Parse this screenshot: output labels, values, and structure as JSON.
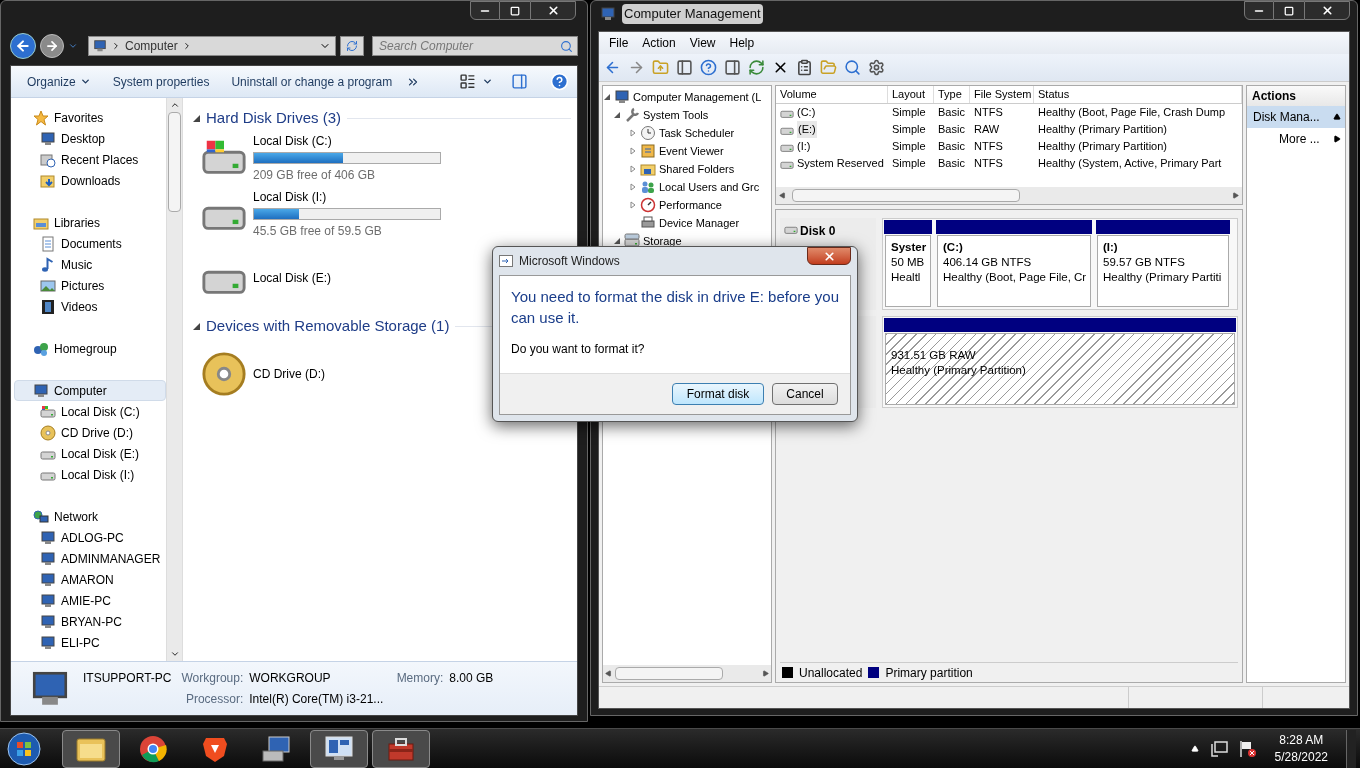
{
  "explorer": {
    "address": {
      "crumbs": [
        "Computer"
      ]
    },
    "search": {
      "placeholder": "Search Computer"
    },
    "commands": [
      {
        "label": "Organize",
        "kind": "menu"
      },
      {
        "label": "System properties",
        "kind": "plain"
      },
      {
        "label": "Uninstall or change a program",
        "kind": "plain"
      }
    ],
    "nav": [
      {
        "label": "Favorites",
        "kind": "star",
        "selected": false,
        "children": [
          {
            "label": "Desktop",
            "kind": "desktop",
            "selected": false
          },
          {
            "label": "Recent Places",
            "kind": "recent",
            "selected": false
          },
          {
            "label": "Downloads",
            "kind": "downloads",
            "selected": false
          }
        ]
      },
      {
        "label": "Libraries",
        "kind": "libraries",
        "selected": false,
        "children": [
          {
            "label": "Documents",
            "kind": "documents",
            "selected": false
          },
          {
            "label": "Music",
            "kind": "music",
            "selected": false
          },
          {
            "label": "Pictures",
            "kind": "pictures",
            "selected": false
          },
          {
            "label": "Videos",
            "kind": "videos",
            "selected": false
          }
        ]
      },
      {
        "label": "Homegroup",
        "kind": "homegroup",
        "selected": false
      },
      {
        "label": "Computer",
        "kind": "computer",
        "selected": true,
        "children": [
          {
            "label": "Local Disk (C:)",
            "kind": "systemdisk",
            "selected": false
          },
          {
            "label": "CD Drive (D:)",
            "kind": "cd",
            "selected": false
          },
          {
            "label": "Local Disk (E:)",
            "kind": "disk",
            "selected": false
          },
          {
            "label": "Local Disk (I:)",
            "kind": "disk",
            "selected": false
          }
        ]
      },
      {
        "label": "Network",
        "kind": "network",
        "selected": false,
        "children": [
          {
            "label": "ADLOG-PC",
            "kind": "pc",
            "selected": false
          },
          {
            "label": "ADMINMANAGER",
            "kind": "pc",
            "selected": false
          },
          {
            "label": "AMARON",
            "kind": "pc",
            "selected": false
          },
          {
            "label": "AMIE-PC",
            "kind": "pc",
            "selected": false
          },
          {
            "label": "BRYAN-PC",
            "kind": "pc",
            "selected": false
          },
          {
            "label": "ELI-PC",
            "kind": "pc",
            "selected": false
          }
        ]
      }
    ],
    "groups": [
      {
        "title": "Hard Disk Drives (3)",
        "items": [
          {
            "name": "Local Disk (C:)",
            "kind": "systemdisk",
            "level": 0.48,
            "free": "209 GB free of 406 GB"
          },
          {
            "name": "Local Disk (I:)",
            "kind": "disk",
            "level": 0.24,
            "free": "45.5 GB free of 59.5 GB"
          },
          {
            "name": "Local Disk (E:)",
            "kind": "disk"
          }
        ]
      },
      {
        "title": "Devices with Removable Storage (1)",
        "items": [
          {
            "name": "CD Drive (D:)",
            "kind": "cd"
          }
        ]
      }
    ],
    "details": {
      "name": "ITSUPPORT-PC",
      "workgroup": {
        "label": "Workgroup:",
        "value": "WORKGROUP"
      },
      "memory": {
        "label": "Memory:",
        "value": "8.00 GB"
      },
      "processor": {
        "label": "Processor:",
        "value": "Intel(R) Core(TM) i3-21..."
      }
    }
  },
  "cm": {
    "title": "Computer Management",
    "menu": [
      "File",
      "Action",
      "View",
      "Help"
    ],
    "tree": [
      {
        "label": "Computer Management (L",
        "kind": "cm",
        "expanded": true,
        "children": [
          {
            "label": "System Tools",
            "kind": "tools",
            "expanded": true,
            "children": [
              {
                "label": "Task Scheduler",
                "kind": "clock",
                "expanded": false
              },
              {
                "label": "Event Viewer",
                "kind": "event",
                "expanded": false
              },
              {
                "label": "Shared Folders",
                "kind": "shared",
                "expanded": false
              },
              {
                "label": "Local Users and Grc",
                "kind": "users",
                "expanded": false
              },
              {
                "label": "Performance",
                "kind": "performance",
                "expanded": false
              },
              {
                "label": "Device Manager",
                "kind": "device"
              }
            ]
          },
          {
            "label": "Storage",
            "kind": "storage",
            "expanded": true
          }
        ]
      }
    ],
    "columns": [
      "Volume",
      "Layout",
      "Type",
      "File System",
      "Status"
    ],
    "volumes": [
      {
        "selected": false,
        "cells": [
          "(C:)",
          "Simple",
          "Basic",
          "NTFS",
          "Healthy (Boot, Page File, Crash Dump"
        ]
      },
      {
        "selected": true,
        "cells": [
          "(E:)",
          "Simple",
          "Basic",
          "RAW",
          "Healthy (Primary Partition)"
        ]
      },
      {
        "selected": false,
        "cells": [
          "(I:)",
          "Simple",
          "Basic",
          "NTFS",
          "Healthy (Primary Partition)"
        ]
      },
      {
        "selected": false,
        "cells": [
          "System Reserved",
          "Simple",
          "Basic",
          "NTFS",
          "Healthy (System, Active, Primary Part"
        ]
      }
    ],
    "disks": [
      {
        "label": "Disk 0",
        "partitions": [
          {
            "name": "Syster",
            "size": "50 MB",
            "status": "Healtl",
            "kind": "primary"
          },
          {
            "name": "(C:)",
            "size": "406.14 GB NTFS",
            "status": "Healthy (Boot, Page File, Cr",
            "kind": "primary"
          },
          {
            "name": "(I:)",
            "size": "59.57 GB NTFS",
            "status": "Healthy (Primary Partiti",
            "kind": "primary"
          }
        ]
      },
      {
        "partitions": [
          {
            "size": "931.51 GB RAW",
            "status": "Healthy (Primary Partition)",
            "kind": "raw"
          }
        ]
      }
    ],
    "legend": [
      {
        "label": "Unallocated",
        "color": "#000000"
      },
      {
        "label": "Primary partition",
        "color": "#000080"
      }
    ],
    "actions": {
      "header": "Actions",
      "items": [
        {
          "label": "Disk Mana...",
          "selected": true
        },
        {
          "label": "More ...",
          "selected": false
        }
      ]
    }
  },
  "dialog": {
    "title": "Microsoft Windows",
    "heading": "You need to format the disk in drive E: before you can use it.",
    "question": "Do you want to format it?",
    "buttons": [
      {
        "label": "Format disk",
        "default": true
      },
      {
        "label": "Cancel",
        "default": false
      }
    ]
  },
  "taskbar": {
    "apps": [
      {
        "kind": "folder",
        "active": true
      },
      {
        "kind": "chrome",
        "active": false
      },
      {
        "kind": "brave",
        "active": false
      },
      {
        "kind": "computer",
        "active": false
      },
      {
        "kind": "management",
        "active": true
      },
      {
        "kind": "toolbox",
        "active": true
      }
    ],
    "clock": {
      "time": "8:28 AM",
      "date": "5/28/2022"
    }
  }
}
